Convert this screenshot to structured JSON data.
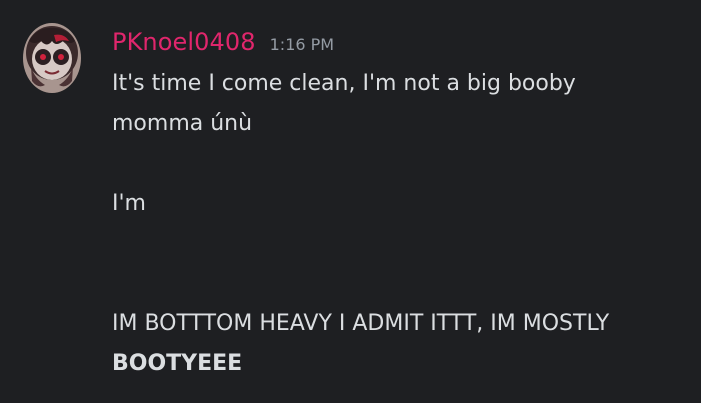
{
  "message": {
    "username": "PKnoel0408",
    "timestamp": "1:16 PM",
    "username_color": "#e0266c",
    "avatar_icon": "user-avatar-image",
    "lines": [
      "It's time I come clean, I'm not a big booby",
      "momma únù",
      "",
      "I'm",
      "",
      "",
      "IM BOTTTOM HEAVY I ADMIT ITTT, IM MOSTLY",
      "BOOTYEEE"
    ]
  },
  "colors": {
    "background": "#1e1f22",
    "text": "#dbdee1",
    "timestamp": "#949ba4"
  }
}
